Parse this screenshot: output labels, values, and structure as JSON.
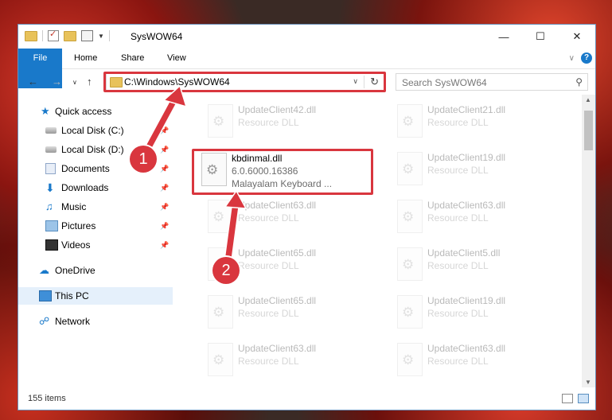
{
  "window": {
    "title": "SysWOW64"
  },
  "ribbon": {
    "tabs": [
      "File",
      "Home",
      "Share",
      "View"
    ],
    "help": "?"
  },
  "nav": {
    "address": "C:\\Windows\\SysWOW64",
    "search_placeholder": "Search SysWOW64"
  },
  "sidebar": {
    "items": [
      {
        "label": "Quick access"
      },
      {
        "label": "Local Disk (C:)"
      },
      {
        "label": "Local Disk (D:)"
      },
      {
        "label": "Documents"
      },
      {
        "label": "Downloads"
      },
      {
        "label": "Music"
      },
      {
        "label": "Pictures"
      },
      {
        "label": "Videos"
      },
      {
        "label": "OneDrive"
      },
      {
        "label": "This PC"
      },
      {
        "label": "Network"
      }
    ]
  },
  "files": {
    "highlighted": {
      "name": "kbdinmal.dll",
      "version": "6.0.6000.16386",
      "desc": "Malayalam Keyboard ..."
    },
    "col1": [
      {
        "name": "UpdateClient42.dll",
        "desc": "Resource DLL"
      },
      {
        "name": "UpdateClient63.dll",
        "desc": "Resource DLL"
      },
      {
        "name": "UpdateClient65.dll",
        "desc": "Resource DLL"
      },
      {
        "name": "UpdateClient65.dll",
        "desc": "Resource DLL"
      },
      {
        "name": "UpdateClient63.dll",
        "desc": "Resource DLL"
      }
    ],
    "col2": [
      {
        "name": "UpdateClient21.dll",
        "desc": "Resource DLL"
      },
      {
        "name": "UpdateClient19.dll",
        "desc": "Resource DLL"
      },
      {
        "name": "UpdateClient63.dll",
        "desc": "Resource DLL"
      },
      {
        "name": "UpdateClient5.dll",
        "desc": "Resource DLL"
      },
      {
        "name": "UpdateClient19.dll",
        "desc": "Resource DLL"
      },
      {
        "name": "UpdateClient63.dll",
        "desc": "Resource DLL"
      }
    ]
  },
  "status": {
    "count": "155 items"
  },
  "annotations": {
    "badge1": "1",
    "badge2": "2"
  },
  "colors": {
    "accent": "#1979ca",
    "highlight": "#d9363e"
  }
}
